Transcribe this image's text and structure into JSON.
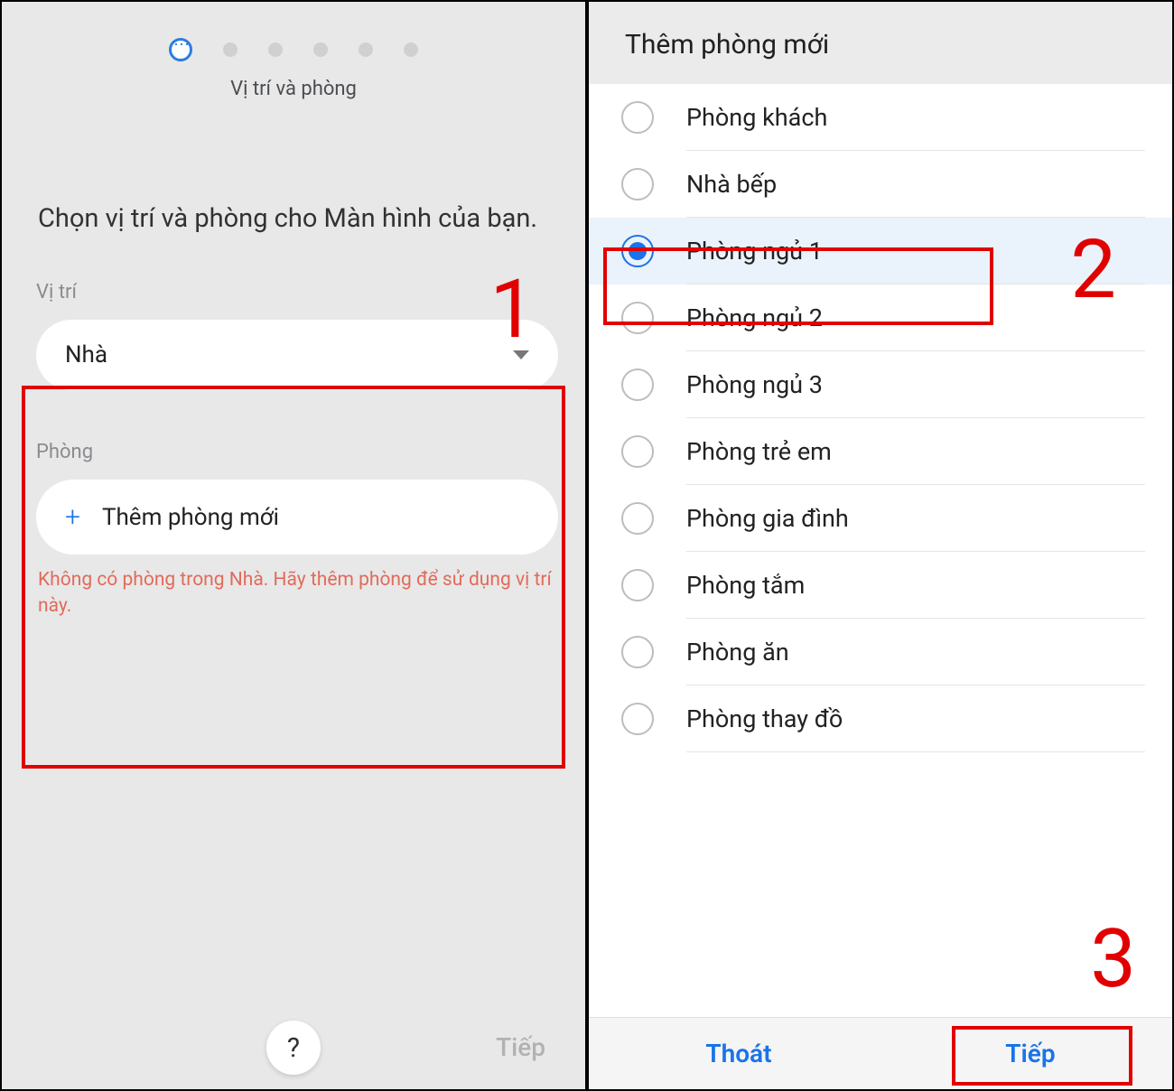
{
  "left": {
    "stepper_label": "Vị trí và phòng",
    "instruction": "Chọn vị trí và phòng cho Màn hình của bạn.",
    "location_label": "Vị trí",
    "location_value": "Nhà",
    "room_label": "Phòng",
    "add_room_label": "Thêm phòng mới",
    "warning": "Không có phòng trong Nhà. Hãy thêm phòng để sử dụng vị trí này.",
    "help": "?",
    "next": "Tiếp"
  },
  "right": {
    "title": "Thêm phòng mới",
    "rooms": [
      {
        "label": "Phòng khách",
        "selected": false
      },
      {
        "label": "Nhà bếp",
        "selected": false
      },
      {
        "label": "Phòng ngủ 1",
        "selected": true
      },
      {
        "label": "Phòng ngủ 2",
        "selected": false
      },
      {
        "label": "Phòng ngủ 3",
        "selected": false
      },
      {
        "label": "Phòng trẻ em",
        "selected": false
      },
      {
        "label": "Phòng gia đình",
        "selected": false
      },
      {
        "label": "Phòng tắm",
        "selected": false
      },
      {
        "label": "Phòng ăn",
        "selected": false
      },
      {
        "label": "Phòng thay đồ",
        "selected": false
      }
    ],
    "footer_exit": "Thoát",
    "footer_next": "Tiếp"
  },
  "annotations": {
    "one": "1",
    "two": "2",
    "three": "3"
  }
}
